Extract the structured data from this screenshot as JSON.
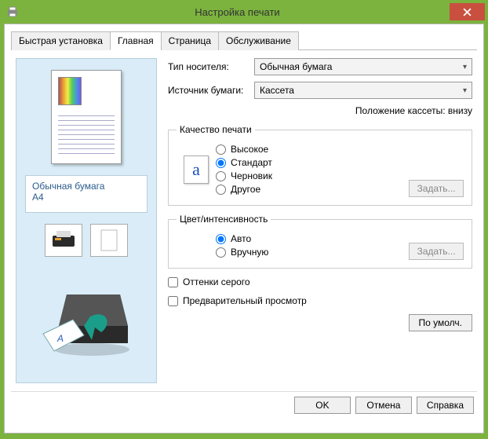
{
  "window": {
    "title": "Настройка печати"
  },
  "tabs": {
    "quick": "Быстрая установка",
    "main": "Главная",
    "page": "Страница",
    "service": "Обслуживание"
  },
  "preview": {
    "media_line1": "Обычная бумага",
    "media_line2": "A4"
  },
  "settings": {
    "media_type_label": "Тип носителя:",
    "media_type_value": "Обычная бумага",
    "paper_source_label": "Источник бумаги:",
    "paper_source_value": "Кассета",
    "cassette_note": "Положение кассеты: внизу",
    "quality": {
      "legend": "Качество печати",
      "high": "Высокое",
      "standard": "Стандарт",
      "draft": "Черновик",
      "other": "Другое",
      "set_btn": "Задать..."
    },
    "color": {
      "legend": "Цвет/интенсивность",
      "auto": "Авто",
      "manual": "Вручную",
      "set_btn": "Задать..."
    },
    "grayscale": "Оттенки серого",
    "preview_check": "Предварительный просмотр",
    "defaults_btn": "По умолч."
  },
  "footer": {
    "ok": "OK",
    "cancel": "Отмена",
    "help": "Справка"
  }
}
